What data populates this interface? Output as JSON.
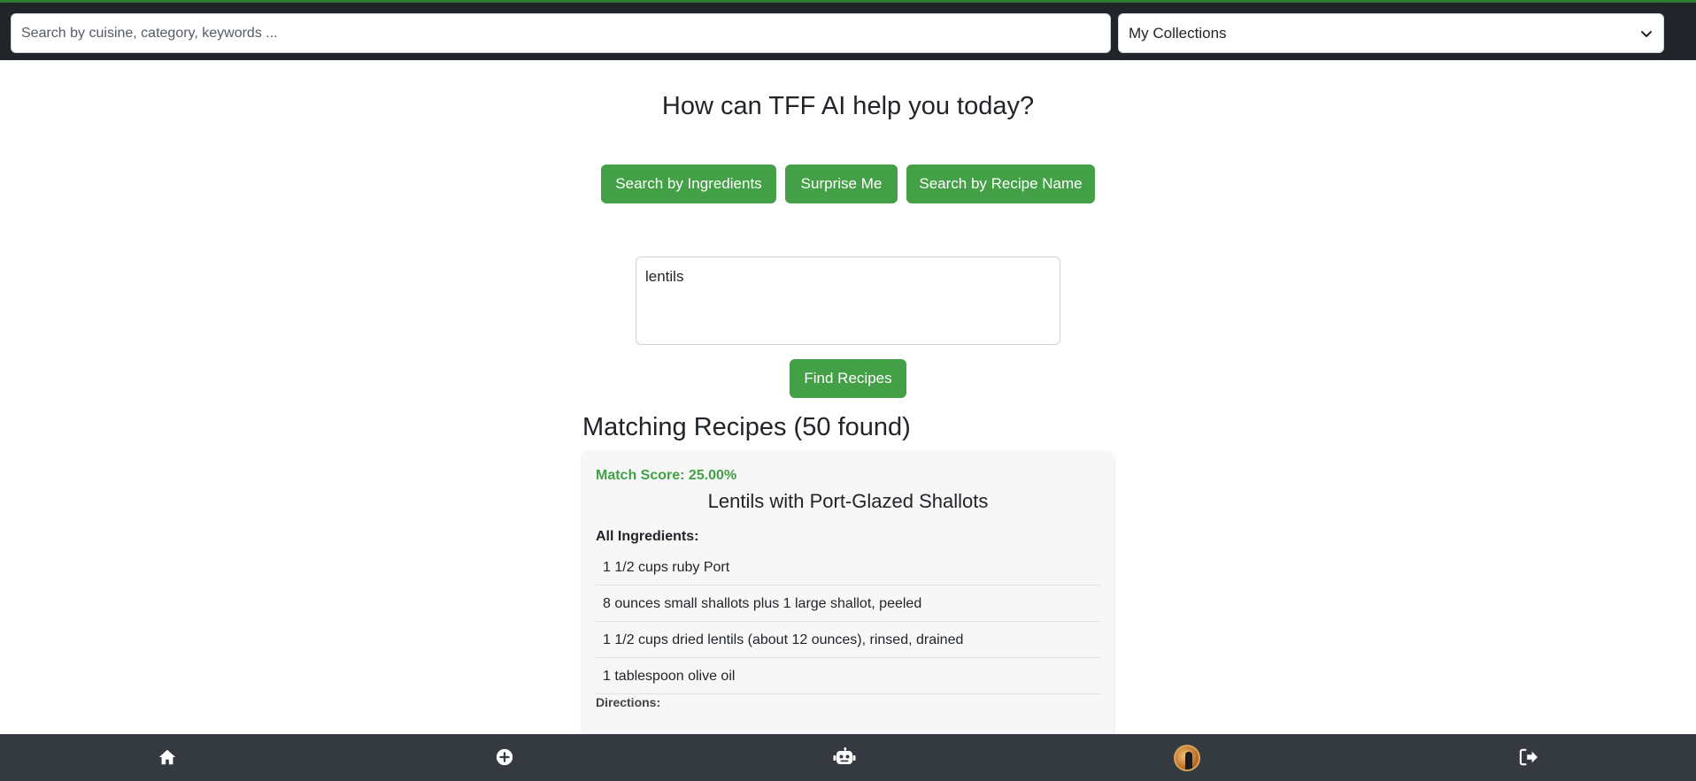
{
  "topbar": {
    "search_placeholder": "Search by cuisine, category, keywords ...",
    "collections_label": "My Collections"
  },
  "main": {
    "heading": "How can TFF AI help you today?",
    "modes": {
      "ingredients": "Search by Ingredients",
      "surprise": "Surprise Me",
      "recipe_name": "Search by Recipe Name"
    },
    "query_value": "lentils",
    "find_label": "Find Recipes",
    "results_title": "Matching Recipes (50 found)"
  },
  "recipe": {
    "match_score": "Match Score: 25.00%",
    "title": "Lentils with Port-Glazed Shallots",
    "ingredients_label": "All Ingredients:",
    "ingredients": [
      "1 1/2 cups ruby Port",
      "8 ounces small shallots plus 1 large shallot, peeled",
      "1 1/2 cups dried lentils (about 12 ounces), rinsed, drained",
      "1 tablespoon olive oil"
    ],
    "directions_label": "Directions:"
  },
  "colors": {
    "accent": "#43a047",
    "topbar": "#212529",
    "bottomnav": "#343a40"
  },
  "bottomnav": {
    "icons": [
      "home-icon",
      "add-circle-icon",
      "robot-icon",
      "avatar",
      "logout-icon"
    ]
  }
}
